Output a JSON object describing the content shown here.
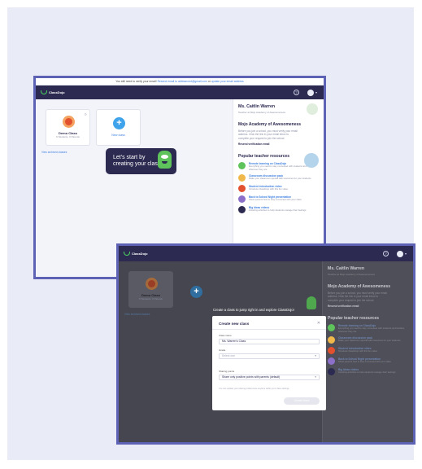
{
  "banner": {
    "text": "You still need to verify your email!",
    "resend_link": "Resend email to abbbanned@gmail.com",
    "or_text": "or",
    "update_link": "update your email address"
  },
  "app": {
    "logo_text": "ClassDojo"
  },
  "classes": {
    "demo": {
      "title": "Demo Class",
      "subtitle": "6 Students, 0 Parents"
    },
    "new_label": "New class",
    "view_link": "View archived classes"
  },
  "tooltip": {
    "line1": "Let's start by",
    "line2": "creating your class!"
  },
  "profile": {
    "name": "Ms. Caitlin Warren",
    "subtitle": "Teacher at Mojo Academy of Awesomeness"
  },
  "school": {
    "title": "Mojo Academy of Awesomeness",
    "text": "Before you join a school, you must verify your email address. Click the link in your email inbox to complete your request to join the school.",
    "resend": "Resend verification email"
  },
  "resources": {
    "title": "Popular teacher resources",
    "items": [
      {
        "title": "Remote learning on ClassDojo",
        "desc": "Everything you need to stay connected with students and families, wherever they are",
        "color": "#5fc35c"
      },
      {
        "title": "Classroom discussion pack",
        "desc": "Make your classroom special with resources for your students",
        "color": "#f0b84a"
      },
      {
        "title": "Student introduction video",
        "desc": "Introduce ClassDojo with this fun video",
        "color": "#e2502e"
      },
      {
        "title": "Back to School Night presentation",
        "desc": "Show parents how to stay connected with your class",
        "color": "#8b6fc9"
      },
      {
        "title": "Big Ideas videos",
        "desc": "Amazing activities to help students manage their feelings",
        "color": "#2c2a50"
      }
    ]
  },
  "overlay": {
    "jump_text": "Create a class to jump right in and explore ClassDojo!"
  },
  "modal": {
    "title": "Create new class",
    "class_name_label": "Class name",
    "class_name_value": "Ms. Warren's Class",
    "grade_label": "Grade",
    "grade_placeholder": "Select one",
    "points_label": "Sharing points",
    "points_value": "Share only positive points with parents (default)",
    "note": "You can update your sharing preferences anytime within your class settings",
    "create_button": "Create class"
  }
}
